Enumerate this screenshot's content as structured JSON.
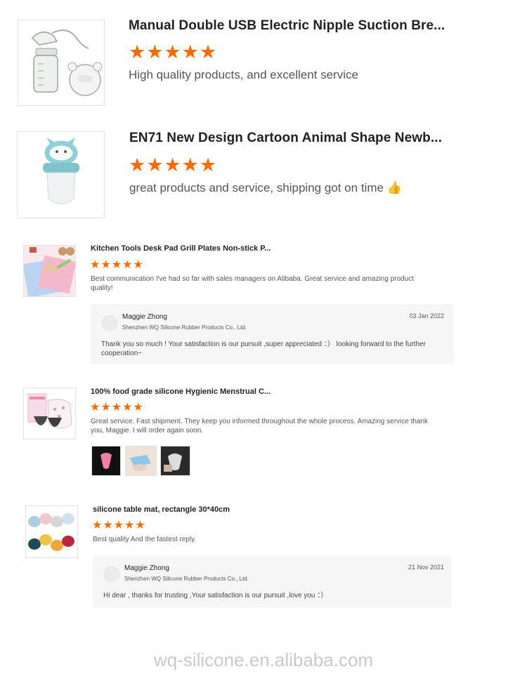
{
  "reviews_large": [
    {
      "product_title": "Manual Double USB Electric Nipple Suction Bre...",
      "stars": "★★★★★",
      "comment": "High quality products, and excellent service",
      "thumb_icon": "breast-pump-product-image"
    },
    {
      "product_title": "EN71 New Design Cartoon Animal Shape Newb...",
      "stars": "★★★★★",
      "comment": "great products and service, shipping got on time 👍",
      "thumb_icon": "baby-feeder-product-image"
    }
  ],
  "reviews_small": [
    {
      "product_title": "Kitchen Tools Desk Pad Grill Plates Non-stick P...",
      "stars": "★★★★★",
      "comment": "Best communication I've had so far with sales managers on Alibaba. Great service and amazing product quality!",
      "reply": {
        "name": "Maggie Zhong",
        "company": "Shenzhen WQ Silicone Rubber Products Co., Ltd.",
        "date": "03 Jan 2022",
        "text": "Thank you so much ! Your satisfaction is our pursuit ,super appreciated ：） looking forward to the further cooperation~"
      }
    },
    {
      "product_title": "100% food grade silicone Hygienic Menstrual C...",
      "stars": "★★★★★",
      "comment": "Great service. Fast shipment. They keep you informed throughout the whole process. Amazing service thank you, Maggie. I will order again soon.",
      "photos": [
        "pink-cup-photo",
        "blue-cup-photo",
        "clear-cup-photo"
      ]
    },
    {
      "product_title": "silicone table mat, rectangle 30*40cm",
      "stars": "★★★★★",
      "comment": "Best quality And the fastest reply.",
      "reply": {
        "name": "Maggie Zhong",
        "company": "Shenzhen WQ Silicone Rubber Products Co., Ltd.",
        "date": "21 Nov 2021",
        "text": "Hi dear , thanks for trusting ,Your satisfaction is our pursuit ,love you ：）"
      }
    }
  ],
  "watermark": "wq-silicone.en.alibaba.com",
  "colors": {
    "star": "#ff6a00",
    "reply_bg": "#f6f6f7"
  }
}
